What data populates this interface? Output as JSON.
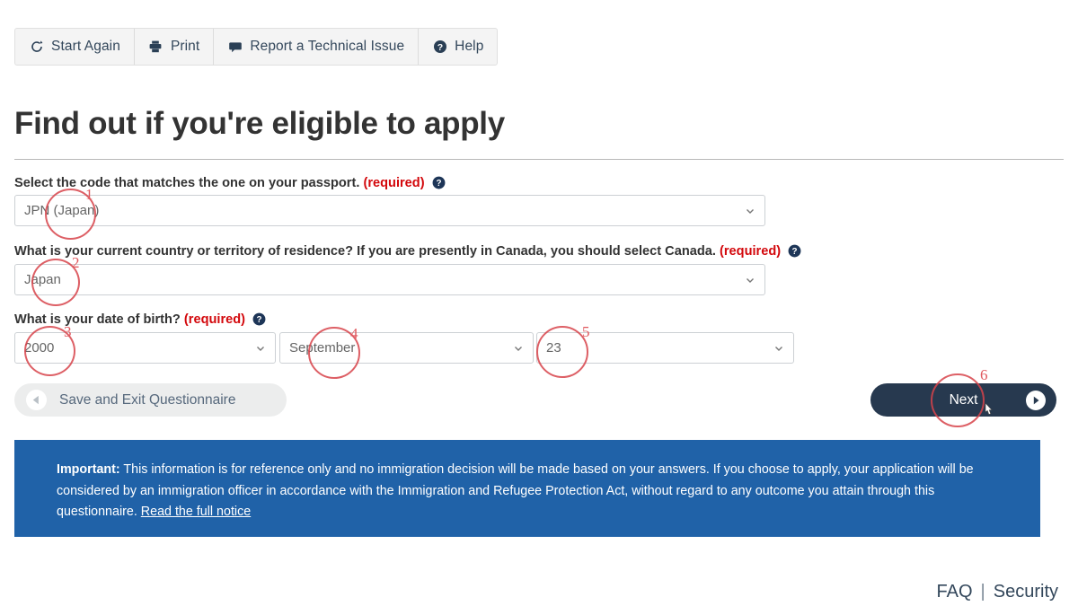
{
  "toolbar": {
    "buttons": [
      {
        "label": "Start Again",
        "icon": "refresh-icon"
      },
      {
        "label": "Print",
        "icon": "printer-icon"
      },
      {
        "label": "Report a Technical Issue",
        "icon": "speech-bubble-icon"
      },
      {
        "label": "Help",
        "icon": "question-circle-icon"
      }
    ]
  },
  "page": {
    "title": "Find out if you're eligible to apply"
  },
  "form": {
    "questions": [
      {
        "label": "Select the code that matches the one on your passport.",
        "required_text": "(required)",
        "value": "JPN (Japan)"
      },
      {
        "label": "What is your current country or territory of residence? If you are presently in Canada, you should select Canada.",
        "required_text": "(required)",
        "value": "Japan"
      },
      {
        "label": "What is your date of birth?",
        "required_text": "(required)",
        "year": "2000",
        "month": "September",
        "day": "23"
      }
    ]
  },
  "actions": {
    "save_exit_label": "Save and Exit Questionnaire",
    "next_label": "Next"
  },
  "notice": {
    "important_label": "Important:",
    "body_1": " This information is for reference only and no immigration decision will be made based on your answers. If you choose to apply, your application will be considered by an immigration officer in accordance with the Immigration and Refugee Protection Act, without regard to any outcome you attain through this questionnaire. ",
    "link_label": "Read the full notice"
  },
  "footer": {
    "faq_label": "FAQ",
    "separator": "|",
    "security_label": "Security"
  },
  "annotations": [
    {
      "number": "1"
    },
    {
      "number": "2"
    },
    {
      "number": "3"
    },
    {
      "number": "4"
    },
    {
      "number": "5"
    },
    {
      "number": "6"
    }
  ],
  "colors": {
    "notice_blue": "#2062a8",
    "next_navy": "#27394f",
    "required_red": "#d3080c",
    "annotation_red": "#d7434a"
  }
}
